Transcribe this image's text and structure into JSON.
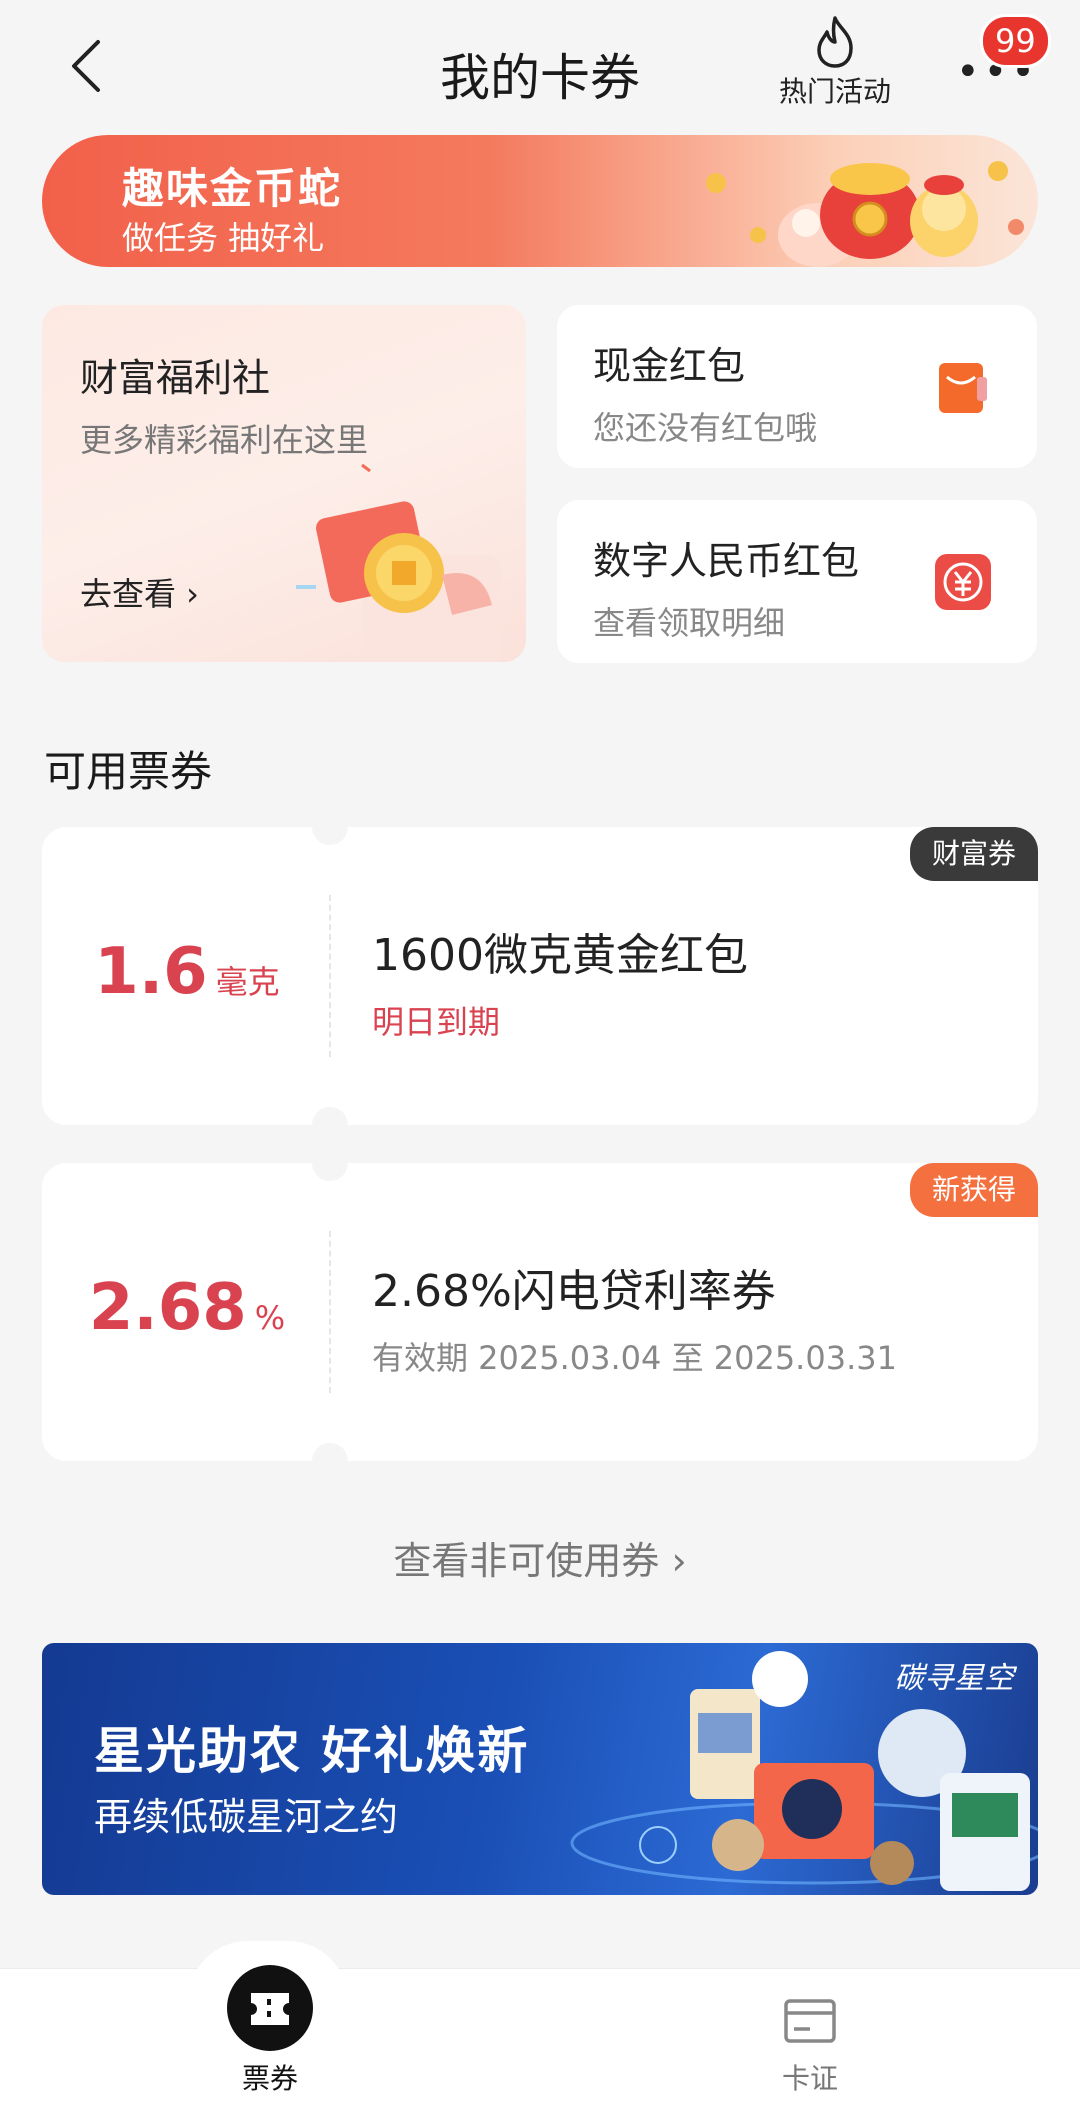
{
  "header": {
    "title": "我的卡券",
    "hot_label": "热门活动",
    "badge_count": "99"
  },
  "promo_banner": {
    "title": "趣味金币蛇",
    "subtitle": "做任务 抽好礼"
  },
  "welfare": {
    "title": "财富福利社",
    "subtitle": "更多精彩福利在这里",
    "link": "去查看 ›"
  },
  "cash_red_packet": {
    "title": "现金红包",
    "subtitle": "您还没有红包哦"
  },
  "digital_rmb": {
    "title": "数字人民币红包",
    "subtitle": "查看领取明细"
  },
  "available_section": {
    "title": "可用票券"
  },
  "coupons": [
    {
      "amount": "1.6",
      "unit": "毫克",
      "name": "1600微克黄金红包",
      "expiry": "明日到期",
      "tag": "财富券"
    },
    {
      "amount": "2.68",
      "unit": "%",
      "name": "2.68%闪电贷利率券",
      "expiry": "有效期 2025.03.04 至 2025.03.31",
      "tag": "新获得"
    }
  ],
  "view_unusable": "查看非可使用券 ›",
  "bottom_banner": {
    "title": "星光助农  好礼焕新",
    "subtitle": "再续低碳星河之约",
    "brand": "碳寻星空"
  },
  "bottom_nav": {
    "tickets": "票券",
    "cards": "卡证"
  },
  "colors": {
    "accent": "#d94350",
    "tag_dark": "#3a3a3a",
    "tag_orange": "#f4703f"
  }
}
